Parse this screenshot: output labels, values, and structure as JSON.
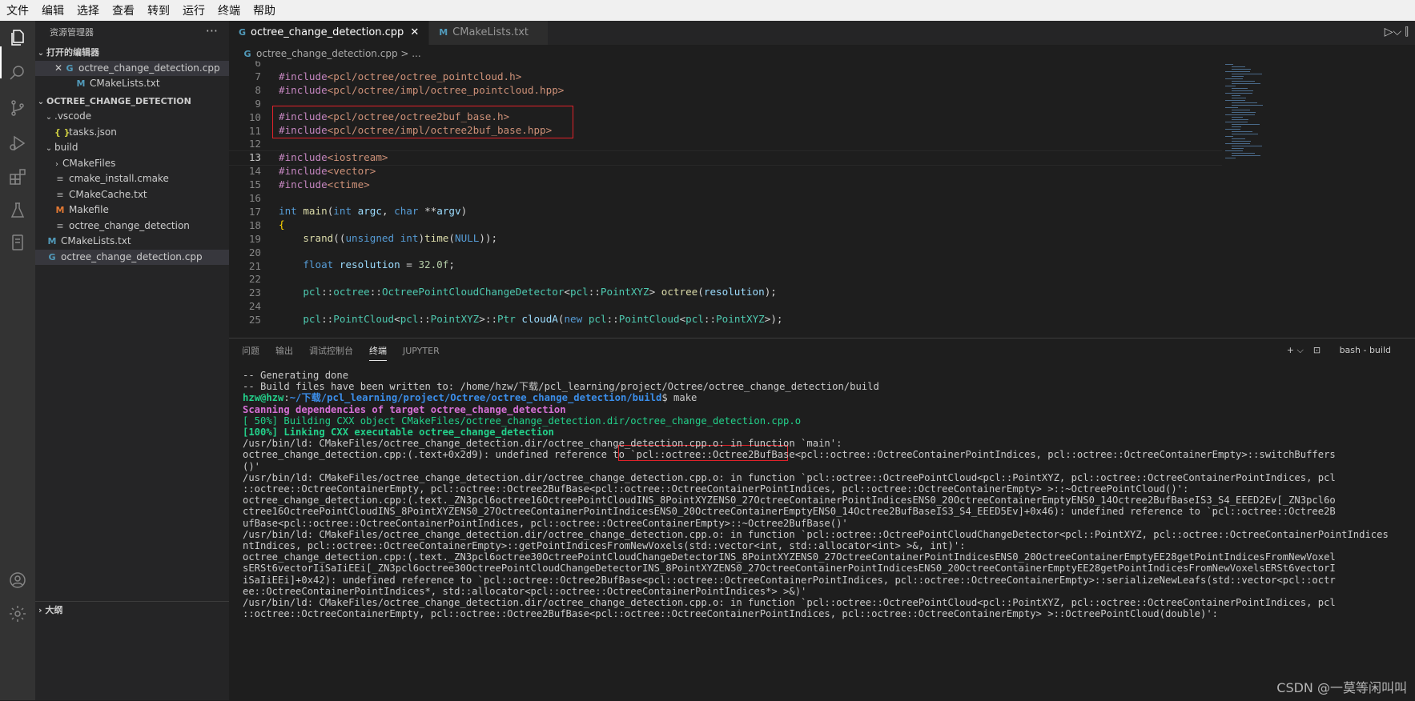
{
  "menu": [
    "文件",
    "编辑",
    "选择",
    "查看",
    "转到",
    "运行",
    "终端",
    "帮助"
  ],
  "explorer": {
    "title": "资源管理器",
    "more": "···",
    "open_editors_header": "打开的编辑器",
    "open_editors": [
      {
        "name": "octree_change_detection.cpp",
        "icon": "cpp-icon"
      },
      {
        "name": "CMakeLists.txt",
        "icon": "cmake-icon"
      }
    ],
    "project_header": "OCTREE_CHANGE_DETECTION",
    "tree": [
      {
        "name": ".vscode",
        "indent": 1,
        "type": "folder-open"
      },
      {
        "name": "tasks.json",
        "indent": 2,
        "type": "json"
      },
      {
        "name": "build",
        "indent": 1,
        "type": "folder-open"
      },
      {
        "name": "CMakeFiles",
        "indent": 2,
        "type": "folder-closed"
      },
      {
        "name": "cmake_install.cmake",
        "indent": 2,
        "type": "txt"
      },
      {
        "name": "CMakeCache.txt",
        "indent": 2,
        "type": "txt"
      },
      {
        "name": "Makefile",
        "indent": 2,
        "type": "makefile"
      },
      {
        "name": "octree_change_detection",
        "indent": 2,
        "type": "txt"
      },
      {
        "name": "CMakeLists.txt",
        "indent": 1,
        "type": "cmake"
      },
      {
        "name": "octree_change_detection.cpp",
        "indent": 1,
        "type": "cpp",
        "selected": true
      }
    ],
    "outline": "大纲"
  },
  "tabs": [
    {
      "label": "octree_change_detection.cpp",
      "active": true
    },
    {
      "label": "CMakeLists.txt",
      "active": false
    }
  ],
  "breadcrumb": "octree_change_detection.cpp > ...",
  "code": {
    "line_numbers": [
      "6",
      "7",
      "8",
      "9",
      "10",
      "11",
      "12",
      "13",
      "14",
      "15",
      "16",
      "17",
      "18",
      "19",
      "20",
      "21",
      "22",
      "23",
      "24",
      "25"
    ],
    "current_line": "13"
  },
  "panel": {
    "tabs": [
      "问题",
      "输出",
      "调试控制台",
      "终端",
      "JUPYTER"
    ],
    "active_tab": "终端",
    "add": "+ ⌵",
    "shell": "bash - build"
  },
  "terminal": {
    "lines": [
      {
        "text": "-- Generating done",
        "style": ""
      },
      {
        "text": "-- Build files have been written to: /home/hzw/下载/pcl_learning/project/Octree/octree_change_detection/build",
        "style": ""
      },
      {
        "prompt_user": "hzw@hzw",
        "prompt_path": "~/下载/pcl_learning/project/Octree/octree_change_detection/build",
        "cmd": "$ make",
        "style": "prompt"
      },
      {
        "text": "Scanning dependencies of target octree_change_detection",
        "style": "mag"
      },
      {
        "text": "[ 50%] Building CXX object CMakeFiles/octree_change_detection.dir/octree_change_detection.cpp.o",
        "style": "green2",
        "prefix": "[ 50%] "
      },
      {
        "text": "[100%] Linking CXX executable octree_change_detection",
        "style": "green",
        "prefix": "[100%] "
      },
      {
        "text": "/usr/bin/ld: CMakeFiles/octree_change_detection.dir/octree_change_detection.cpp.o: in function `main':",
        "style": ""
      },
      {
        "text": "octree_change_detection.cpp:(.text+0x2d9): undefined reference to `pcl::octree::Octree2BufBase<pcl::octree::OctreeContainerPointIndices, pcl::octree::OctreeContainerEmpty>::switchBuffers",
        "style": ""
      },
      {
        "text": "()'",
        "style": ""
      },
      {
        "text": "/usr/bin/ld: CMakeFiles/octree_change_detection.dir/octree_change_detection.cpp.o: in function `pcl::octree::OctreePointCloud<pcl::PointXYZ, pcl::octree::OctreeContainerPointIndices, pcl",
        "style": ""
      },
      {
        "text": "::octree::OctreeContainerEmpty, pcl::octree::Octree2BufBase<pcl::octree::OctreeContainerPointIndices, pcl::octree::OctreeContainerEmpty> >::~OctreePointCloud()':",
        "style": ""
      },
      {
        "text": "octree_change_detection.cpp:(.text._ZN3pcl6octree16OctreePointCloudINS_8PointXYZENS0_27OctreeContainerPointIndicesENS0_20OctreeContainerEmptyENS0_14Octree2BufBaseIS3_S4_EEED2Ev[_ZN3pcl6o",
        "style": ""
      },
      {
        "text": "ctree16OctreePointCloudINS_8PointXYZENS0_27OctreeContainerPointIndicesENS0_20OctreeContainerEmptyENS0_14Octree2BufBaseIS3_S4_EEED5Ev]+0x46): undefined reference to `pcl::octree::Octree2B",
        "style": ""
      },
      {
        "text": "ufBase<pcl::octree::OctreeContainerPointIndices, pcl::octree::OctreeContainerEmpty>::~Octree2BufBase()'",
        "style": ""
      },
      {
        "text": "/usr/bin/ld: CMakeFiles/octree_change_detection.dir/octree_change_detection.cpp.o: in function `pcl::octree::OctreePointCloudChangeDetector<pcl::PointXYZ, pcl::octree::OctreeContainerPointIndices",
        "style": ""
      },
      {
        "text": "ntIndices, pcl::octree::OctreeContainerEmpty>::getPointIndicesFromNewVoxels(std::vector<int, std::allocator<int> >&, int)':",
        "style": ""
      },
      {
        "text": "octree_change_detection.cpp:(.text._ZN3pcl6octree30OctreePointCloudChangeDetectorINS_8PointXYZENS0_27OctreeContainerPointIndicesENS0_20OctreeContainerEmptyEE28getPointIndicesFromNewVoxel",
        "style": ""
      },
      {
        "text": "sERSt6vectorIiSaIiEEi[_ZN3pcl6octree30OctreePointCloudChangeDetectorINS_8PointXYZENS0_27OctreeContainerPointIndicesENS0_20OctreeContainerEmptyEE28getPointIndicesFromNewVoxelsERSt6vectorI",
        "style": ""
      },
      {
        "text": "iSaIiEEi]+0x42): undefined reference to `pcl::octree::Octree2BufBase<pcl::octree::OctreeContainerPointIndices, pcl::octree::OctreeContainerEmpty>::serializeNewLeafs(std::vector<pcl::octr",
        "style": ""
      },
      {
        "text": "ee::OctreeContainerPointIndices*, std::allocator<pcl::octree::OctreeContainerPointIndices*> >&)'",
        "style": ""
      },
      {
        "text": "/usr/bin/ld: CMakeFiles/octree_change_detection.dir/octree_change_detection.cpp.o: in function `pcl::octree::OctreePointCloud<pcl::PointXYZ, pcl::octree::OctreeContainerPointIndices, pcl",
        "style": ""
      },
      {
        "text": "::octree::OctreeContainerEmpty, pcl::octree::Octree2BufBase<pcl::octree::OctreeContainerPointIndices, pcl::octree::OctreeContainerEmpty> >::OctreePointCloud(double)':",
        "style": ""
      }
    ]
  },
  "watermark": "CSDN @一莫等闲叫叫",
  "colors": {
    "highlight_box": "#e0222a",
    "accent": "#007acc"
  }
}
